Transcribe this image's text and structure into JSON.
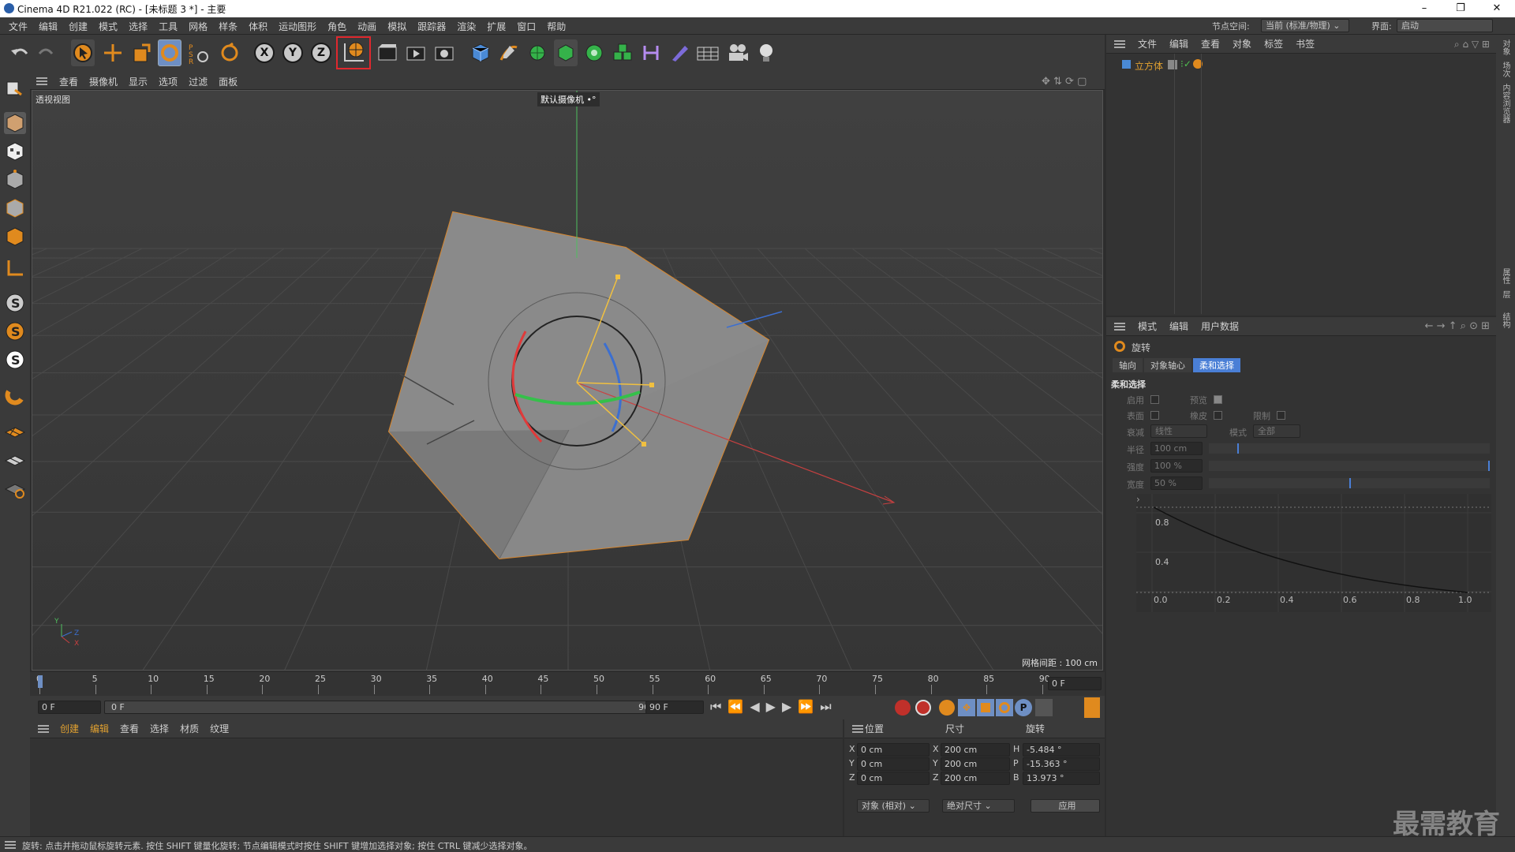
{
  "app": {
    "title": "Cinema 4D R21.022 (RC) - [未标题 3 *] - 主要",
    "win_min": "–",
    "win_restore": "❐",
    "win_close": "✕"
  },
  "menubar": {
    "items": [
      "文件",
      "编辑",
      "创建",
      "模式",
      "选择",
      "工具",
      "网格",
      "样条",
      "体积",
      "运动图形",
      "角色",
      "动画",
      "模拟",
      "跟踪器",
      "渲染",
      "扩展",
      "窗口",
      "帮助"
    ],
    "node_space_label": "节点空间:",
    "node_space_value": "当前 (标准/物理)",
    "layout_label": "界面:",
    "layout_value": "启动"
  },
  "toolbar": {
    "axis_x": "X",
    "axis_y": "Y",
    "axis_z": "Z",
    "psr_label": "PSR"
  },
  "viewport": {
    "menu": [
      "查看",
      "摄像机",
      "显示",
      "选项",
      "过滤",
      "面板"
    ],
    "view_name": "透视视图",
    "camera": "默认摄像机",
    "grid_spacing": "网格间距 : 100 cm",
    "axis_y": "Y",
    "axis_z": "Z",
    "axis_x": "X"
  },
  "timeline": {
    "ticks": [
      "0",
      "5",
      "10",
      "15",
      "20",
      "25",
      "30",
      "35",
      "40",
      "45",
      "50",
      "55",
      "60",
      "65",
      "70",
      "75",
      "80",
      "85",
      "90"
    ],
    "frame_display": "0 F"
  },
  "transport": {
    "start_frame": "0 F",
    "range_start": "0 F",
    "range_end": "90 F",
    "end_frame": "90 F"
  },
  "material_manager": {
    "menu": [
      "创建",
      "编辑",
      "查看",
      "选择",
      "材质",
      "纹理"
    ]
  },
  "coordinates": {
    "headers": [
      "位置",
      "尺寸",
      "旋转"
    ],
    "rows": [
      {
        "axis": "X",
        "pos": "0 cm",
        "size_axis": "X",
        "size": "200 cm",
        "rot_axis": "H",
        "rot": "-5.484 °"
      },
      {
        "axis": "Y",
        "pos": "0 cm",
        "size_axis": "Y",
        "size": "200 cm",
        "rot_axis": "P",
        "rot": "-15.363 °"
      },
      {
        "axis": "Z",
        "pos": "0 cm",
        "size_axis": "Z",
        "size": "200 cm",
        "rot_axis": "B",
        "rot": "13.973 °"
      }
    ],
    "mode": "对象 (相对)",
    "size_mode": "绝对尺寸",
    "apply": "应用"
  },
  "object_manager": {
    "menu": [
      "文件",
      "编辑",
      "查看",
      "对象",
      "标签",
      "书签"
    ],
    "object_name": "立方体"
  },
  "attribute_manager": {
    "menu": [
      "模式",
      "编辑",
      "用户数据"
    ],
    "tool_name": "旋转",
    "tabs": [
      "轴向",
      "对象轴心",
      "柔和选择"
    ],
    "active_tab": "柔和选择",
    "section": "柔和选择",
    "enable": "启用",
    "preview": "预览",
    "surface": "表面",
    "rubber": "橡皮",
    "restrict": "限制",
    "falloff_label": "衰减",
    "falloff_value": "线性",
    "mode_label": "模式",
    "mode_value": "全部",
    "radius_label": "半径",
    "radius_value": "100 cm",
    "strength_label": "强度",
    "strength_value": "100 %",
    "width_label": "宽度",
    "width_value": "50 %",
    "graph_y_ticks": [
      "0.8",
      "0.4"
    ],
    "graph_x_ticks": [
      "0.0",
      "0.2",
      "0.4",
      "0.6",
      "0.8",
      "1.0"
    ],
    "expand_glyph": "›"
  },
  "right_strip": {
    "tabs": [
      "对象",
      "场次",
      "内容浏览器",
      "属性",
      "层",
      "结构"
    ]
  },
  "status": {
    "text": "旋转: 点击并拖动鼠标旋转元素. 按住 SHIFT 键量化旋转; 节点编辑模式时按住 SHIFT 键增加选择对象; 按住 CTRL 键减少选择对象。"
  },
  "watermark": "最需教育",
  "colors": {
    "accent": "#4a7fd6",
    "highlight_box": "#e0282e",
    "selection": "#d8862c"
  }
}
